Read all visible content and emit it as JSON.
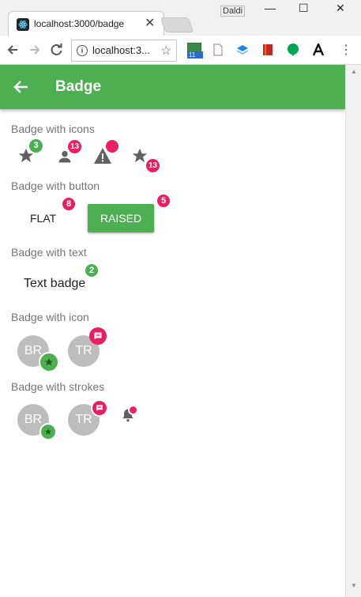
{
  "browser": {
    "tab_title": "localhost:3000/badge",
    "tab_close": "✕",
    "profile_name": "Daldi",
    "url": "localhost:3...",
    "ext_calendar_label": "11",
    "window_minimize": "—",
    "window_maximize": "☐",
    "window_close": "✕"
  },
  "appbar": {
    "title": "Badge"
  },
  "sections": {
    "icons": "Badge with icons",
    "button": "Badge with button",
    "text": "Badge with text",
    "icon": "Badge with icon",
    "strokes": "Badge with strokes"
  },
  "icons_row": {
    "star_badge": "3",
    "person_badge": "13",
    "star2_badge": "13"
  },
  "button_row": {
    "flat_label": "FLAT",
    "flat_badge": "8",
    "raised_label": "RAISED",
    "raised_badge": "5"
  },
  "text_row": {
    "label": "Text badge",
    "badge": "2"
  },
  "icon_row": {
    "avatar1": "BR",
    "avatar2": "TR"
  },
  "strokes_row": {
    "avatar1": "BR",
    "avatar2": "TR"
  },
  "colors": {
    "primary": "#4caf50",
    "accent": "#e91e63",
    "icon_grey": "#616161",
    "avatar_grey": "#bdbdbd"
  }
}
